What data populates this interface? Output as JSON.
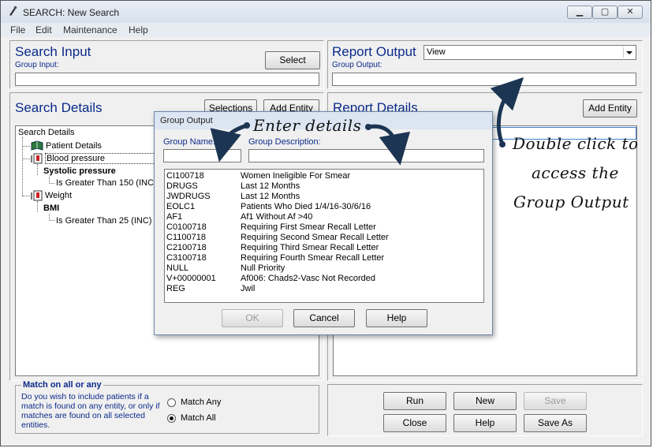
{
  "window": {
    "title": "SEARCH: New Search",
    "minimize": "▁",
    "maximize": "▢",
    "close": "✕"
  },
  "menu": [
    "File",
    "Edit",
    "Maintenance",
    "Help"
  ],
  "search_input": {
    "heading": "Search Input",
    "group_input_label": "Group Input:",
    "group_input_value": "",
    "select_label": "Select"
  },
  "report_output": {
    "heading": "Report Output",
    "dropdown_value": "View",
    "group_output_label": "Group Output:",
    "group_output_value": ""
  },
  "search_details": {
    "heading": "Search Details",
    "selections_label": "Selections",
    "add_entity_label": "Add Entity",
    "tree": {
      "root": "Search Details",
      "patient_details": "Patient Details",
      "blood_pressure": "Blood pressure",
      "systolic": "Systolic pressure",
      "systolic_cond": "Is Greater Than 150 (INC)",
      "weight": "Weight",
      "bmi": "BMI",
      "bmi_cond": "Is Greater Than 25 (INC)"
    }
  },
  "report_details": {
    "heading": "Report Details",
    "add_entity_label": "Add Entity"
  },
  "match": {
    "heading": "Match on all or any",
    "description": "Do you wish to include patients if a match is found on any entity, or only if matches are found on all selected entities.",
    "any_label": "Match Any",
    "all_label": "Match All",
    "selected": "Match All"
  },
  "actions": {
    "run": "Run",
    "new": "New",
    "save": "Save",
    "close": "Close",
    "help": "Help",
    "save_as": "Save As"
  },
  "dialog": {
    "title": "Group Output",
    "name_label": "Group Name:",
    "description_label": "Group Description:",
    "name_value": "",
    "description_value": "",
    "rows": [
      {
        "code": "CI100718",
        "desc": "Women Ineligible For Smear"
      },
      {
        "code": "DRUGS",
        "desc": "Last 12 Months"
      },
      {
        "code": "JWDRUGS",
        "desc": "Last 12 Months"
      },
      {
        "code": "EOLC1",
        "desc": "Patients Who Died 1/4/16-30/6/16"
      },
      {
        "code": "AF1",
        "desc": "Af1 Without Af >40"
      },
      {
        "code": "C0100718",
        "desc": "Requiring First Smear Recall Letter"
      },
      {
        "code": "C1100718",
        "desc": "Requiring Second Smear Recall Letter"
      },
      {
        "code": "C2100718",
        "desc": "Requiring Third Smear Recall Letter"
      },
      {
        "code": "C3100718",
        "desc": "Requiring Fourth Smear Recall Letter"
      },
      {
        "code": "NULL",
        "desc": "Null Priority"
      },
      {
        "code": "V+00000001",
        "desc": "Af006: Chads2-Vasc Not Recorded"
      },
      {
        "code": "REG",
        "desc": "Jwil"
      }
    ],
    "ok_label": "OK",
    "cancel_label": "Cancel",
    "help_label": "Help"
  },
  "annotations": {
    "enter_details": "Enter details",
    "double_click_1": "Double click to",
    "double_click_2": "access the",
    "double_click_3": "Group Output"
  }
}
